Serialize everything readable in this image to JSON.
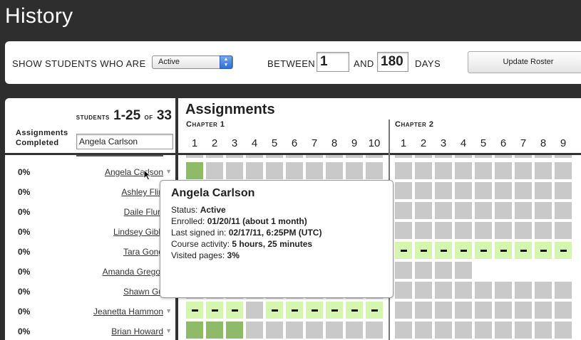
{
  "page": {
    "title": "History"
  },
  "filter": {
    "show_label": "SHOW STUDENTS WHO ARE",
    "status_value": "Active",
    "between_label": "BETWEEN",
    "from_days": "1",
    "and_label": "AND",
    "to_days": "180",
    "days_label": "DAYS",
    "update_button": "Update Roster"
  },
  "students_header": {
    "prefix": "Students",
    "range": "1-25",
    "of": "of",
    "total": "33",
    "assignments_completed_line1": "Assignments",
    "assignments_completed_line2": "Completed",
    "search_value": "Angela Carlson"
  },
  "assignments": {
    "title": "Assignments",
    "chapters": [
      {
        "label": "Chapter 1",
        "numbers": [
          "1",
          "2",
          "3",
          "4",
          "5",
          "6",
          "7",
          "8",
          "9",
          "10"
        ]
      },
      {
        "label": "Chapter 2",
        "numbers": [
          "1",
          "2",
          "3",
          "4",
          "5",
          "6",
          "7",
          "8",
          "9"
        ]
      }
    ]
  },
  "students": [
    {
      "pct": "0%",
      "name": "Angela Carlson",
      "ch1": "dggggggggg",
      "ch2": "ggggggggg"
    },
    {
      "pct": "0%",
      "name": "Ashley Flin",
      "ch1": "gggggggggg",
      "ch2": "ggggggggg"
    },
    {
      "pct": "0%",
      "name": "Daile Flurr",
      "ch1": "gggggggggg",
      "ch2": "ggggggggg"
    },
    {
      "pct": "0%",
      "name": "Lindsey Gibb",
      "ch1": "gggggggggg",
      "ch2": "ggggggggg"
    },
    {
      "pct": "0%",
      "name": "Tara Gong",
      "ch1": "----------",
      "ch2": "---------"
    },
    {
      "pct": "0%",
      "name": "Amanda Gregor",
      "ch1": "gggggggggg",
      "ch2": "gggg"
    },
    {
      "pct": "0%",
      "name": "Shawn Gu",
      "ch1": "gggggggggg",
      "ch2": "ggggggggg"
    },
    {
      "pct": "0%",
      "name": "Jeanetta Hammon",
      "ch1": "---g------",
      "ch2": "ggggggggg"
    },
    {
      "pct": "0%",
      "name": "Brian Howard",
      "ch1": "dddggggggg",
      "ch2": "ggggggggg"
    }
  ],
  "tooltip": {
    "name": "Angela Carlson",
    "status_label": "Status:",
    "status_value": "Active",
    "enrolled_label": "Enrolled:",
    "enrolled_value": "01/20/11 (about 1 month)",
    "last_signed_label": "Last signed in:",
    "last_signed_value": "02/17/11, 6:25PM (UTC)",
    "activity_label": "Course activity:",
    "activity_value": "5 hours, 25 minutes",
    "visited_label": "Visited pages:",
    "visited_value": "3%"
  },
  "colors": {
    "complete": "#8fba6a",
    "dash": "#d5f6ae",
    "empty": "#c9c9c9",
    "chrome": "#2e2e2e"
  }
}
